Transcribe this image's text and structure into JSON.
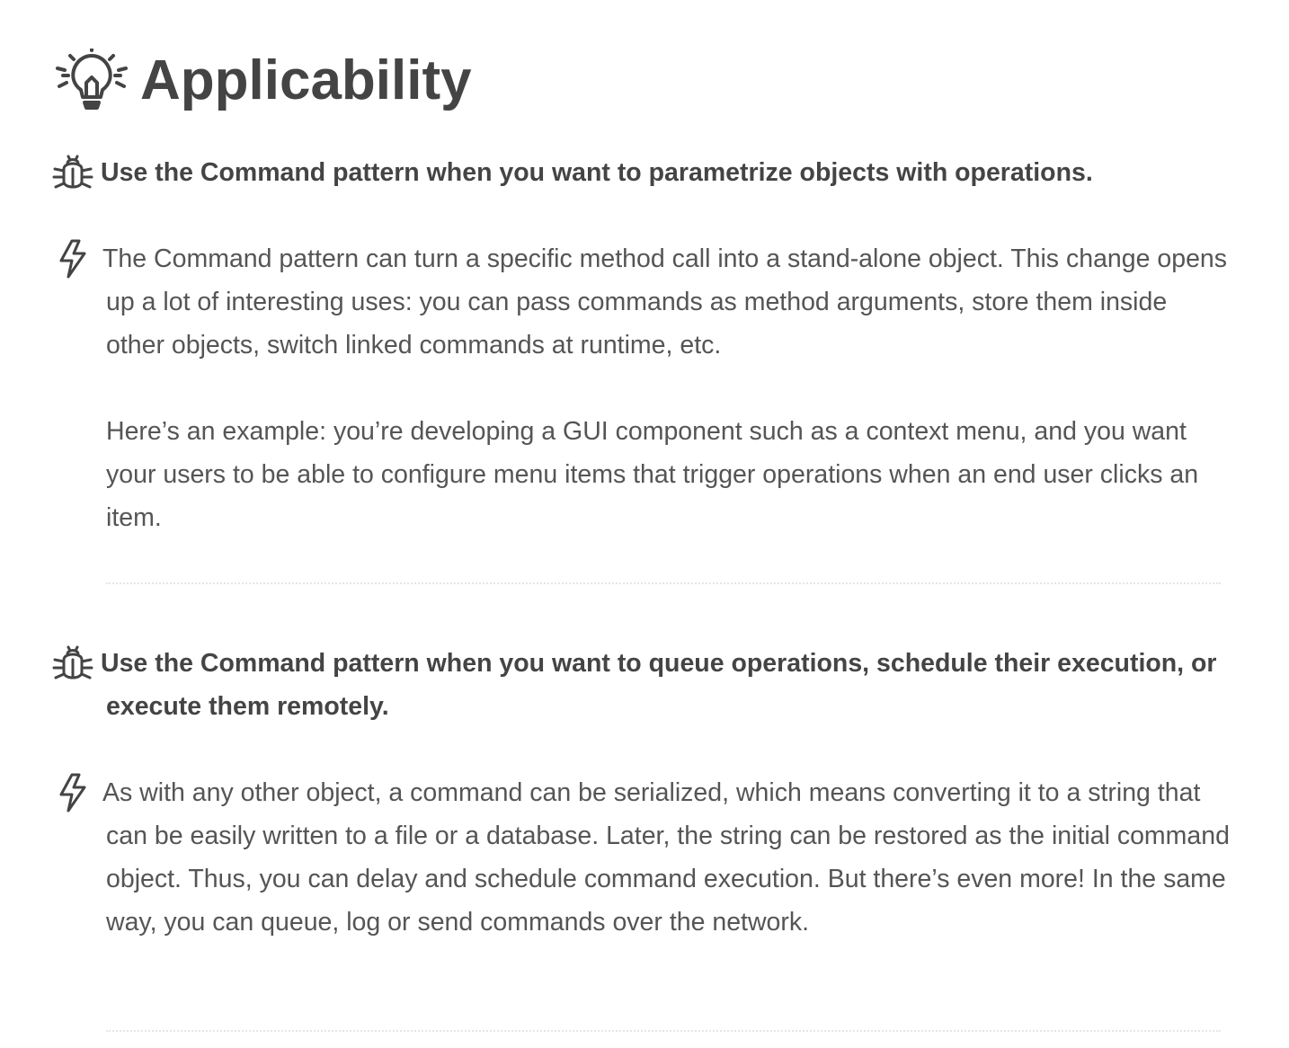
{
  "heading": {
    "icon": "lightbulb-icon",
    "title": "Applicability"
  },
  "items": [
    {
      "problem_icon": "bug-icon",
      "problem": "Use the Command pattern when you want to parametrize objects with operations.",
      "solution_icon": "lightning-icon",
      "solution_paragraphs": [
        "The Command pattern can turn a specific method call into a stand-alone object. This change opens up a lot of interesting uses: you can pass commands as method arguments, store them inside other objects, switch linked commands at runtime, etc.",
        "Here’s an example: you’re developing a GUI component such as a context menu, and you want your users to be able to configure menu items that trigger operations when an end user clicks an item."
      ]
    },
    {
      "problem_icon": "bug-icon",
      "problem": "Use the Command pattern when you want to queue operations, schedule their execution, or execute them remotely.",
      "solution_icon": "lightning-icon",
      "solution_paragraphs": [
        "As with any other object, a command can be serialized, which means converting it to a string that can be easily written to a file or a database. Later, the string can be restored as the initial command object. Thus, you can delay and schedule command execution. But there’s even more! In the same way, you can queue, log or send commands over the network."
      ]
    }
  ],
  "colors": {
    "heading": "#444444",
    "text": "#555555",
    "divider": "#e6e6e6"
  }
}
